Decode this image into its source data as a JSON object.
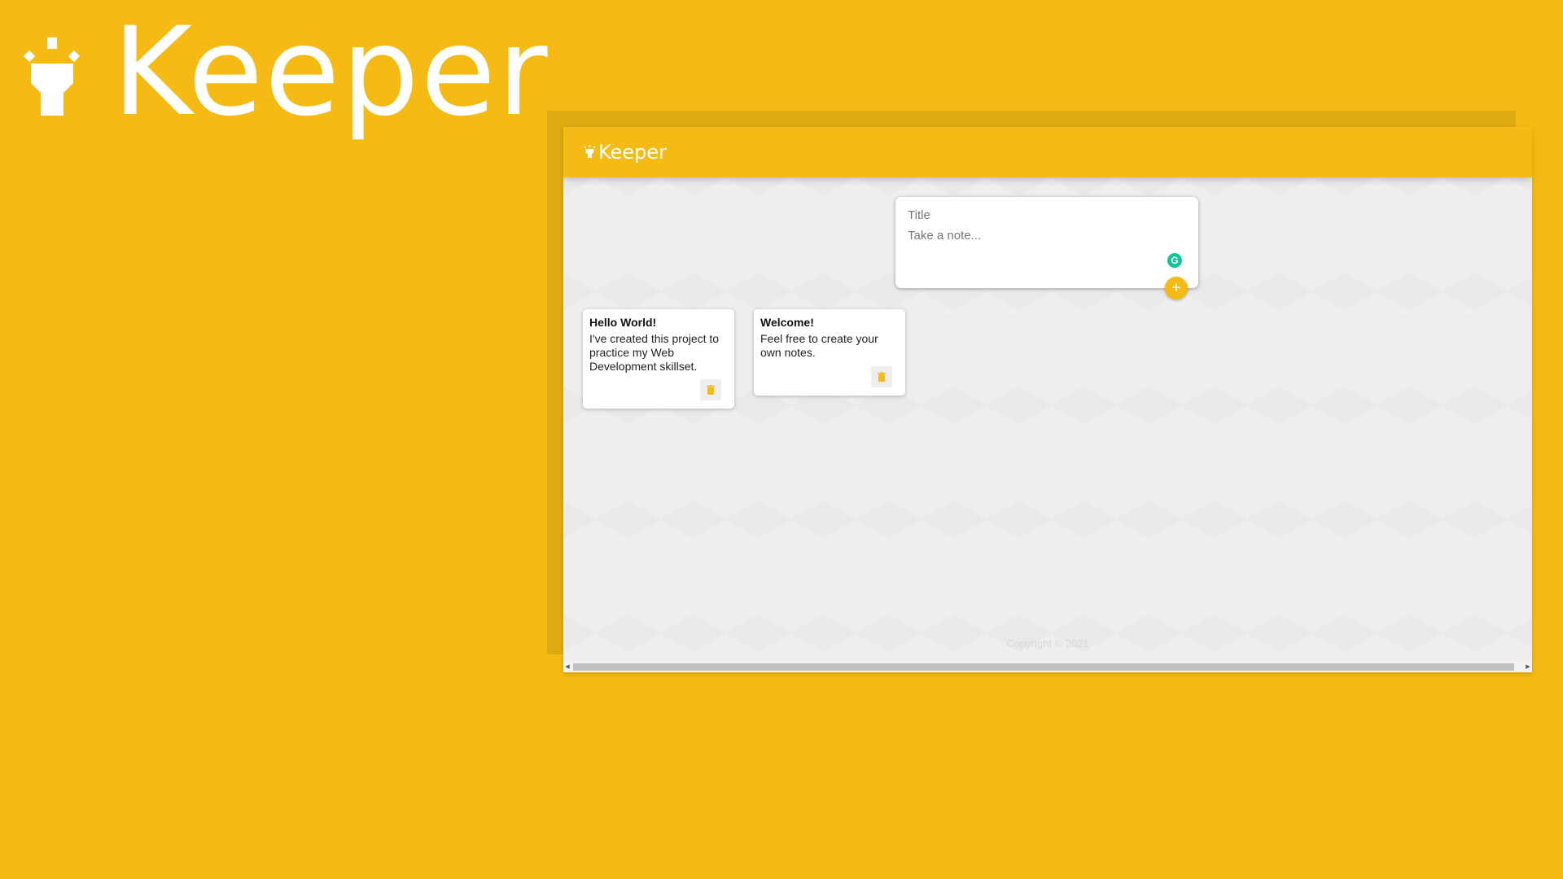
{
  "brand": {
    "hero_title": "Keeper",
    "header_title": "Keeper",
    "color_primary": "#F5BA13"
  },
  "create_note": {
    "title_placeholder": "Title",
    "content_placeholder": "Take a note...",
    "add_icon": "plus-icon",
    "add_label": "+",
    "grammarly_icon": "grammarly-icon",
    "grammarly_label": "G"
  },
  "notes": [
    {
      "title": "Hello World!",
      "content": "I've created this project to practice my Web Development skillset.",
      "delete_icon": "trash-icon"
    },
    {
      "title": "Welcome!",
      "content": "Feel free to create your own notes.",
      "delete_icon": "trash-icon"
    }
  ],
  "footer": {
    "copyright": "Copyright © 2021"
  }
}
